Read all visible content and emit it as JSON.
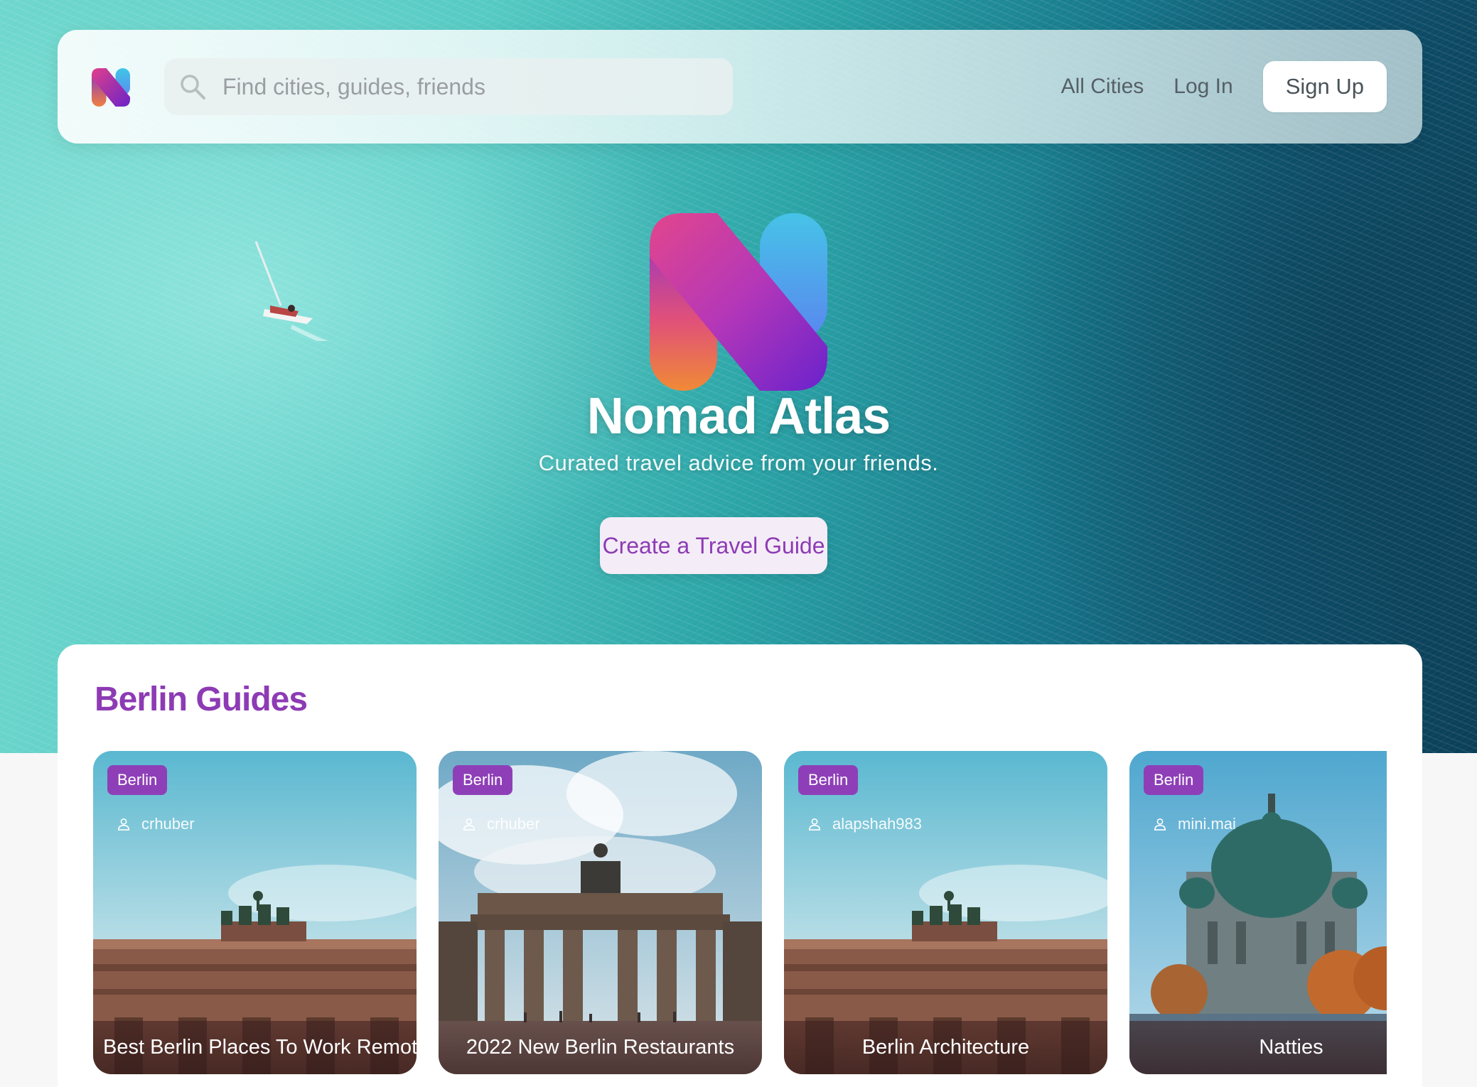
{
  "app": {
    "name": "Nomad Atlas",
    "tagline": "Curated travel advice from your friends.",
    "brand_colors": {
      "purple": "#8d3bb4",
      "tag_purple": "#8e3fb8",
      "cta_bg": "#f4ecf7"
    }
  },
  "nav": {
    "logo_icon": "nomad-atlas-logo-icon",
    "search_placeholder": "Find cities, guides, friends",
    "search_value": "",
    "links": [
      "All Cities",
      "Log In"
    ],
    "signup_label": "Sign Up"
  },
  "hero": {
    "cta_label": "Create a Travel Guide"
  },
  "guides": {
    "title": "Berlin Guides",
    "cards": [
      {
        "tag": "Berlin",
        "author": "crhuber",
        "title": "Best Berlin Places To Work Remotely",
        "scene": "brandenburg-gate-close"
      },
      {
        "tag": "Berlin",
        "author": "crhuber",
        "title": "2022 New Berlin Restaurants",
        "scene": "brandenburg-gate-wide"
      },
      {
        "tag": "Berlin",
        "author": "alapshah983",
        "title": "Berlin Architecture",
        "scene": "brandenburg-gate-close"
      },
      {
        "tag": "Berlin",
        "author": "mini.mai",
        "title": "Natties",
        "scene": "berlin-cathedral"
      }
    ]
  }
}
